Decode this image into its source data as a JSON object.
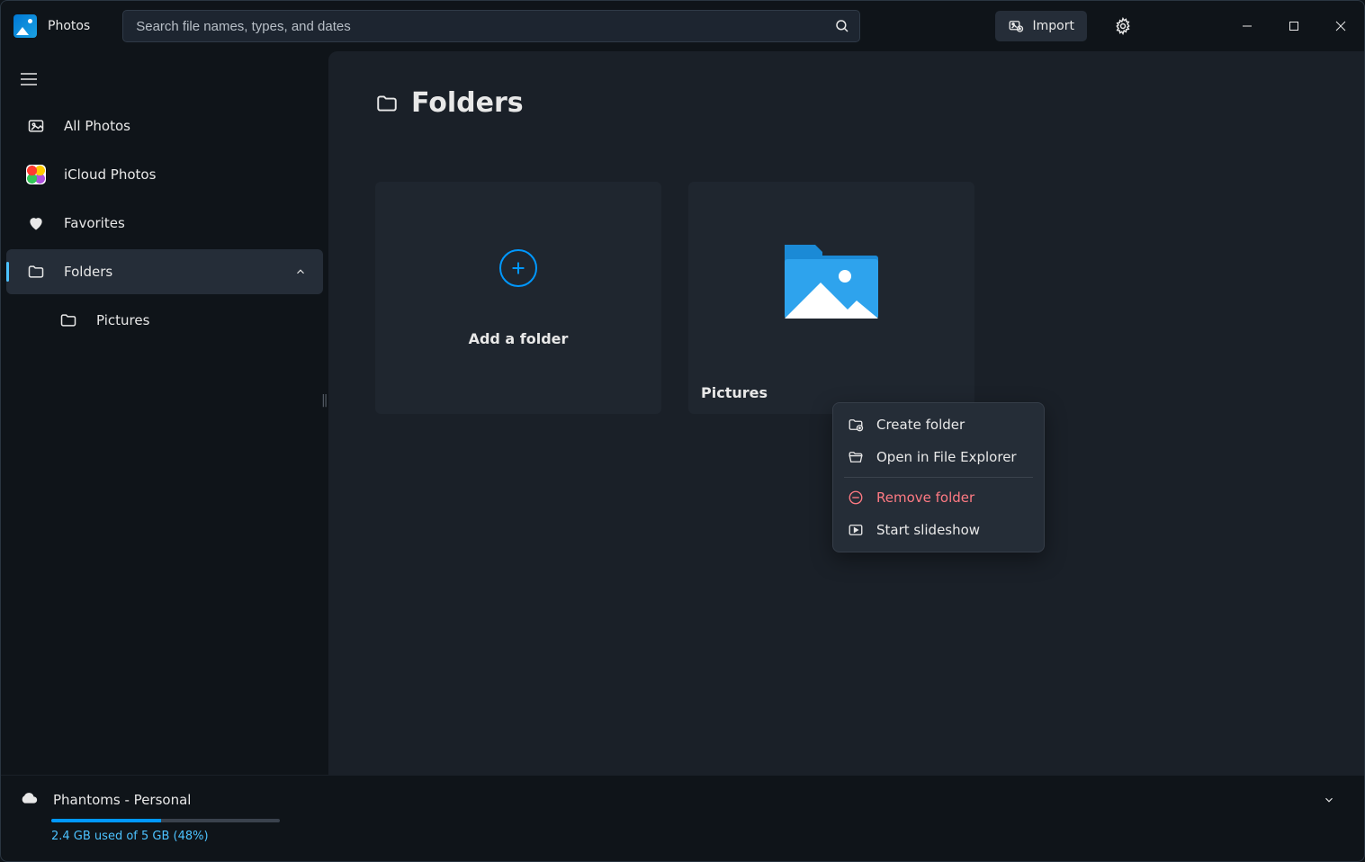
{
  "app": {
    "name": "Photos"
  },
  "search": {
    "placeholder": "Search file names, types, and dates"
  },
  "toolbar": {
    "import_label": "Import"
  },
  "sidebar": {
    "items": [
      {
        "label": "All Photos"
      },
      {
        "label": "iCloud Photos"
      },
      {
        "label": "Favorites"
      },
      {
        "label": "Folders"
      }
    ],
    "folders_children": [
      {
        "label": "Pictures"
      }
    ]
  },
  "main": {
    "title": "Folders",
    "add_card_label": "Add a folder",
    "folder_cards": [
      {
        "name": "Pictures"
      }
    ]
  },
  "context_menu": {
    "create": "Create folder",
    "open": "Open in File Explorer",
    "remove": "Remove folder",
    "slideshow": "Start slideshow"
  },
  "footer": {
    "account": "Phantoms - Personal",
    "storage": "2.4 GB used of 5 GB (48%)",
    "percent": 48
  }
}
